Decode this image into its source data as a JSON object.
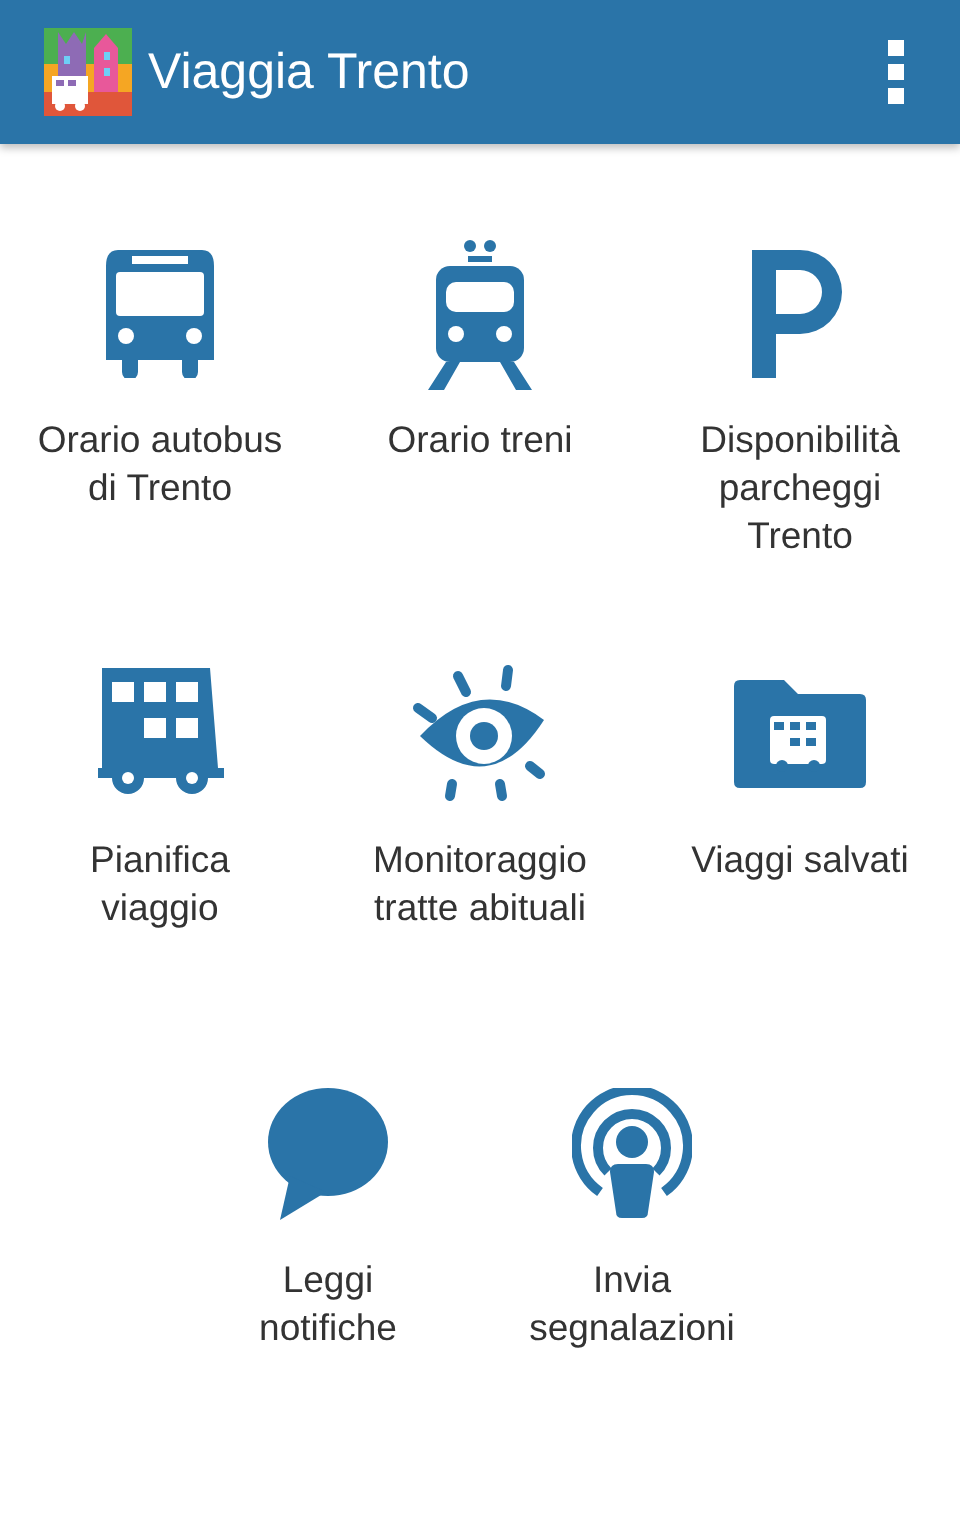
{
  "app_bar": {
    "title": "Viaggia Trento"
  },
  "rows": [
    [
      {
        "kind": "bus",
        "label": "Orario autobus\ndi Trento"
      },
      {
        "kind": "train",
        "label": "Orario treni"
      },
      {
        "kind": "parking",
        "label": "Disponibilità\nparcheggi\nTrento"
      }
    ],
    [
      {
        "kind": "doubledecker",
        "label": "Pianifica\nviaggio"
      },
      {
        "kind": "eye",
        "label": "Monitoraggio\ntratte abituali"
      },
      {
        "kind": "folder",
        "label": "Viaggi salvati"
      }
    ],
    [
      {
        "kind": "chat",
        "label": "Leggi\nnotifiche"
      },
      {
        "kind": "broadcast",
        "label": "Invia\nsegnalazioni"
      }
    ]
  ]
}
